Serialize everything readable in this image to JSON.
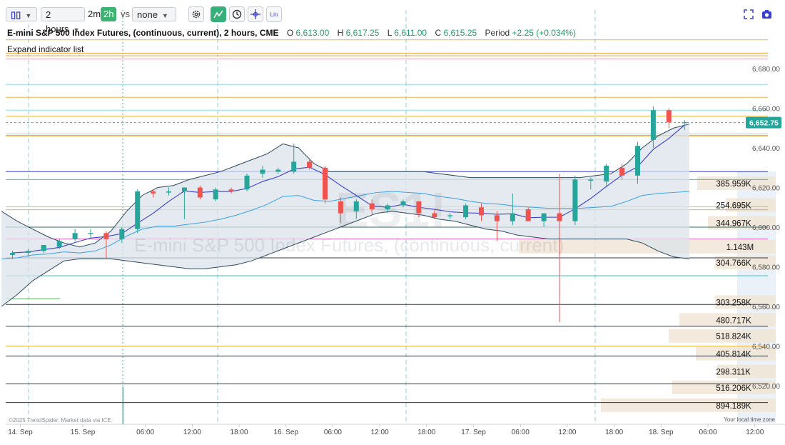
{
  "toolbar": {
    "candle_select_label": "",
    "interval_select": "2 hours",
    "quick_2m": "2m",
    "quick_2h": "2h",
    "vs_label": "vs",
    "compare_select": "none",
    "lin_label": "Lin",
    "icons": [
      "candlestick-icon",
      "gear-icon",
      "indicator-icon",
      "clock-icon",
      "crosshair-icon",
      "lin-icon",
      "fullscreen-icon",
      "camera-icon"
    ]
  },
  "header": {
    "title": "E-mini S&P 500 Index Futures, (continuous, current), 2 hours, CME",
    "o_label": "O",
    "o_value": "6,613.00",
    "h_label": "H",
    "h_value": "6,617.25",
    "l_label": "L",
    "l_value": "6,611.00",
    "c_label": "C",
    "c_value": "6,615.25",
    "period_label": "Period",
    "period_value": "+2.25 (+0.034%)",
    "expand_label": "Expand indicator list"
  },
  "footer": {
    "credit": "©2025 TrendSpider. Market data via ICE.",
    "timezone": "Your local time zone"
  },
  "colors": {
    "up": "#26a69a",
    "down": "#ef5350",
    "band_fill": "#dbe3ea",
    "band_line": "#2d4a5e",
    "ma_line": "#3b3fd1",
    "price_badge": "#26a69a",
    "vp_bar": "#f1e5d6",
    "vp_value": "#dbe6f2"
  },
  "watermark": "E-mini S&P 500 Index Futures, (continuous, current)",
  "watermark_symbol": "ES1!",
  "chart_data": {
    "type": "candlestick",
    "ylim": [
      6505,
      6705
    ],
    "y_ticks": [
      6520,
      6540,
      6560,
      6580,
      6600,
      6620,
      6640,
      6660,
      6680
    ],
    "y_tick_labels": [
      "6,520.00",
      "6,540.00",
      "6,560.00",
      "6,580.00",
      "6,600.00",
      "6,620.00",
      "6,640.00",
      "6,660.00",
      "6,680.00"
    ],
    "x_ticks": [
      "14. Sep",
      "15. Sep",
      "06:00",
      "12:00",
      "18:00",
      "16. Sep",
      "06:00",
      "12:00",
      "18:00",
      "17. Sep",
      "06:00",
      "12:00",
      "18:00",
      "18. Sep",
      "06:00",
      "12:00"
    ],
    "x_tick_index": [
      0.5,
      4.5,
      8.5,
      11.5,
      14.5,
      17.5,
      20.5,
      23.5,
      26.5,
      29.5,
      32.5,
      35.5,
      38.5,
      41.5,
      44.5,
      47.5
    ],
    "candles": [
      {
        "o": 6586,
        "h": 6588,
        "l": 6584,
        "c": 6587
      },
      {
        "o": 6587,
        "h": 6589,
        "l": 6585,
        "c": 6588
      },
      {
        "o": 6588,
        "h": 6591,
        "l": 6587,
        "c": 6591
      },
      {
        "o": 6590,
        "h": 6594,
        "l": 6589,
        "c": 6593
      },
      {
        "o": 6594,
        "h": 6599,
        "l": 6593,
        "c": 6597
      },
      {
        "o": 6597,
        "h": 6599,
        "l": 6594,
        "c": 6597
      },
      {
        "o": 6597,
        "h": 6598,
        "l": 6584,
        "c": 6594
      },
      {
        "o": 6594,
        "h": 6600,
        "l": 6592,
        "c": 6599
      },
      {
        "o": 6599,
        "h": 6619,
        "l": 6597,
        "c": 6618
      },
      {
        "o": 6618,
        "h": 6619,
        "l": 6615,
        "c": 6617
      },
      {
        "o": 6618,
        "h": 6620,
        "l": 6616,
        "c": 6618
      },
      {
        "o": 6618,
        "h": 6619,
        "l": 6604,
        "c": 6620
      },
      {
        "o": 6620,
        "h": 6621,
        "l": 6614,
        "c": 6615
      },
      {
        "o": 6614,
        "h": 6620,
        "l": 6613,
        "c": 6619
      },
      {
        "o": 6619,
        "h": 6620,
        "l": 6617,
        "c": 6618
      },
      {
        "o": 6619,
        "h": 6627,
        "l": 6618,
        "c": 6626
      },
      {
        "o": 6627,
        "h": 6631,
        "l": 6625,
        "c": 6629
      },
      {
        "o": 6628,
        "h": 6630,
        "l": 6627,
        "c": 6629
      },
      {
        "o": 6628,
        "h": 6642,
        "l": 6627,
        "c": 6633
      },
      {
        "o": 6633,
        "h": 6634,
        "l": 6629,
        "c": 6630
      },
      {
        "o": 6630,
        "h": 6631,
        "l": 6612,
        "c": 6614
      },
      {
        "o": 6613,
        "h": 6615,
        "l": 6602,
        "c": 6607
      },
      {
        "o": 6608,
        "h": 6614,
        "l": 6604,
        "c": 6613
      },
      {
        "o": 6612,
        "h": 6614,
        "l": 6606,
        "c": 6609
      },
      {
        "o": 6609,
        "h": 6612,
        "l": 6607,
        "c": 6611
      },
      {
        "o": 6611,
        "h": 6614,
        "l": 6610,
        "c": 6613
      },
      {
        "o": 6613,
        "h": 6613,
        "l": 6605,
        "c": 6607
      },
      {
        "o": 6607,
        "h": 6609,
        "l": 6604,
        "c": 6605
      },
      {
        "o": 6606,
        "h": 6607,
        "l": 6604,
        "c": 6606
      },
      {
        "o": 6605,
        "h": 6612,
        "l": 6604,
        "c": 6611
      },
      {
        "o": 6610,
        "h": 6612,
        "l": 6603,
        "c": 6606
      },
      {
        "o": 6606,
        "h": 6608,
        "l": 6593,
        "c": 6603
      },
      {
        "o": 6603,
        "h": 6617,
        "l": 6601,
        "c": 6607
      },
      {
        "o": 6609,
        "h": 6610,
        "l": 6603,
        "c": 6603
      },
      {
        "o": 6603,
        "h": 6607,
        "l": 6600,
        "c": 6607
      },
      {
        "o": 6607,
        "h": 6627,
        "l": 6552,
        "c": 6603
      },
      {
        "o": 6603,
        "h": 6626,
        "l": 6601,
        "c": 6624
      },
      {
        "o": 6624,
        "h": 6625,
        "l": 6619,
        "c": 6624
      },
      {
        "o": 6623,
        "h": 6632,
        "l": 6620,
        "c": 6631
      },
      {
        "o": 6630,
        "h": 6632,
        "l": 6624,
        "c": 6626
      },
      {
        "o": 6626,
        "h": 6643,
        "l": 6622,
        "c": 6641
      },
      {
        "o": 6644,
        "h": 6661,
        "l": 6640,
        "c": 6659
      },
      {
        "o": 6659,
        "h": 6660,
        "l": 6650,
        "c": 6653
      },
      {
        "o": 6653,
        "h": 6654,
        "l": 6649,
        "c": 6653
      }
    ],
    "last_price": 6652.75,
    "last_price_label": "6,652.75",
    "volume_profile": [
      {
        "price": 6622,
        "value": "385.959K"
      },
      {
        "price": 6611,
        "value": "254.695K"
      },
      {
        "price": 6602,
        "value": "344.967K"
      },
      {
        "price": 6590,
        "value": "1.143M"
      },
      {
        "price": 6582,
        "value": "304.766K"
      },
      {
        "price": 6562,
        "value": "303.258K"
      },
      {
        "price": 6553,
        "value": "480.717K"
      },
      {
        "price": 6545,
        "value": "518.824K"
      },
      {
        "price": 6536,
        "value": "405.814K"
      },
      {
        "price": 6527,
        "value": "298.311K"
      },
      {
        "price": 6519,
        "value": "516.206K"
      },
      {
        "price": 6510,
        "value": "894.189K"
      }
    ],
    "grid": false
  }
}
